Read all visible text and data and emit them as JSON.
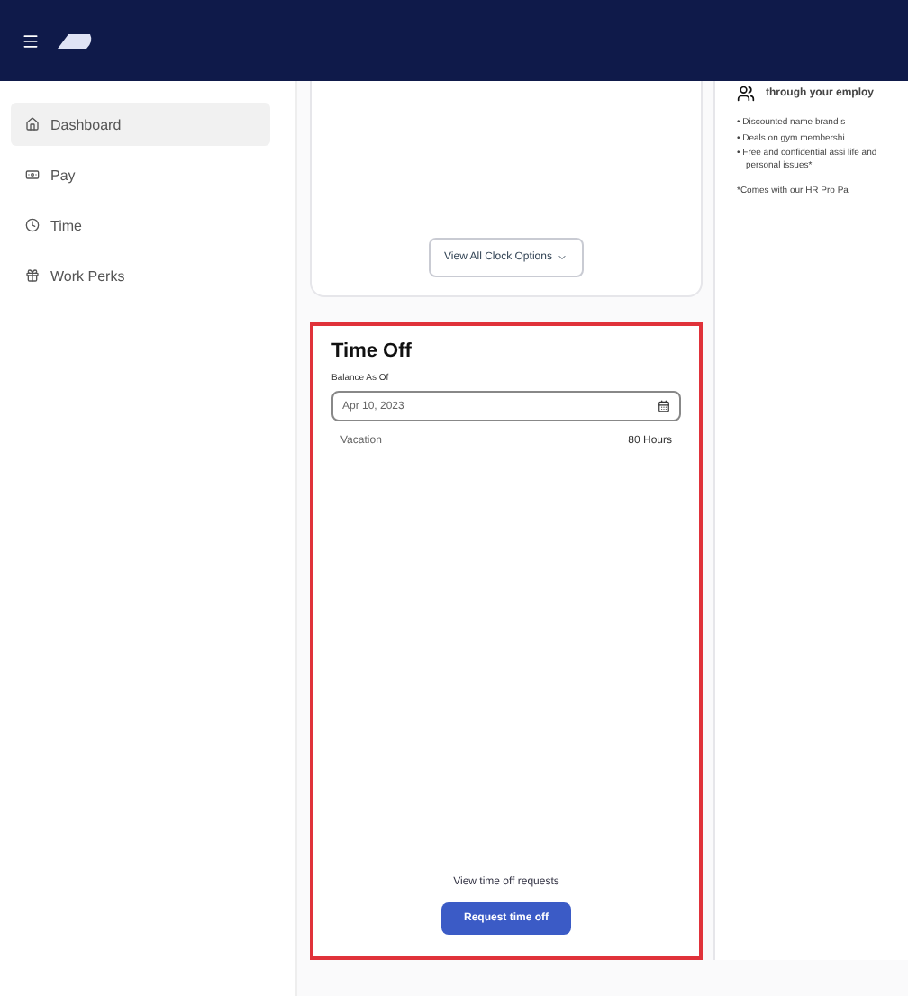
{
  "sidebar": {
    "items": [
      {
        "label": "Dashboard",
        "selected": true
      },
      {
        "label": "Pay",
        "selected": false
      },
      {
        "label": "Time",
        "selected": false
      },
      {
        "label": "Work Perks",
        "selected": false
      }
    ]
  },
  "clock_card": {
    "button": "View All Clock Options"
  },
  "perks_card": {
    "heading_tail": "through your employ",
    "bullets": [
      "• Discounted name brand s",
      "• Deals on gym membershi",
      "• Free and confidential assi life and personal issues*"
    ],
    "footnote": "*Comes with our HR Pro Pa"
  },
  "time_off": {
    "title": "Time Off",
    "balance_label": "Balance As Of",
    "date": "Apr 10, 2023",
    "balances": [
      {
        "type": "Vacation",
        "amount": "80 Hours"
      }
    ],
    "link": "View time off requests",
    "button": "Request time off"
  }
}
